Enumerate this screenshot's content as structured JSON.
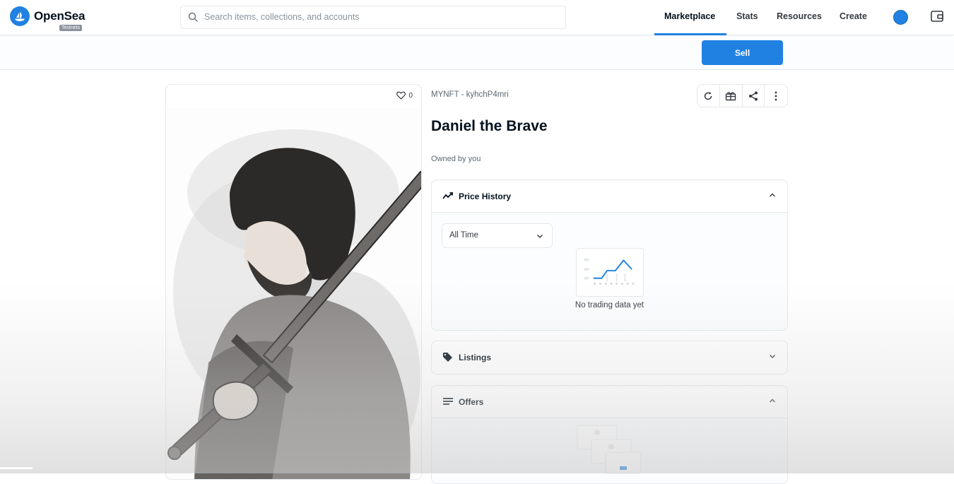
{
  "brand": {
    "name": "OpenSea",
    "badge": "Testnets"
  },
  "search": {
    "placeholder": "Search items, collections, and accounts"
  },
  "nav": {
    "items": [
      {
        "label": "Marketplace",
        "active": true
      },
      {
        "label": "Stats"
      },
      {
        "label": "Resources"
      },
      {
        "label": "Create"
      }
    ]
  },
  "actions": {
    "sell_label": "Sell"
  },
  "item": {
    "favorites": "0",
    "collection": "MYNFT - kyhchP4mri",
    "title": "Daniel the Brave",
    "owner_line": "Owned by you"
  },
  "panels": {
    "price_history": {
      "title": "Price History",
      "filter": "All Time",
      "empty": "No trading data yet"
    },
    "listings": {
      "title": "Listings"
    },
    "offers": {
      "title": "Offers"
    }
  },
  "colors": {
    "accent": "#2081e2",
    "text": "#04111d",
    "muted": "#8a939b"
  },
  "icons": [
    "opensea-logo-icon",
    "search-icon",
    "avatar",
    "wallet-icon",
    "heart-icon",
    "refresh-icon",
    "transfer-icon",
    "share-icon",
    "more-icon",
    "trend-icon",
    "tag-icon",
    "list-icon",
    "chevron-up-icon",
    "chevron-down-icon"
  ]
}
